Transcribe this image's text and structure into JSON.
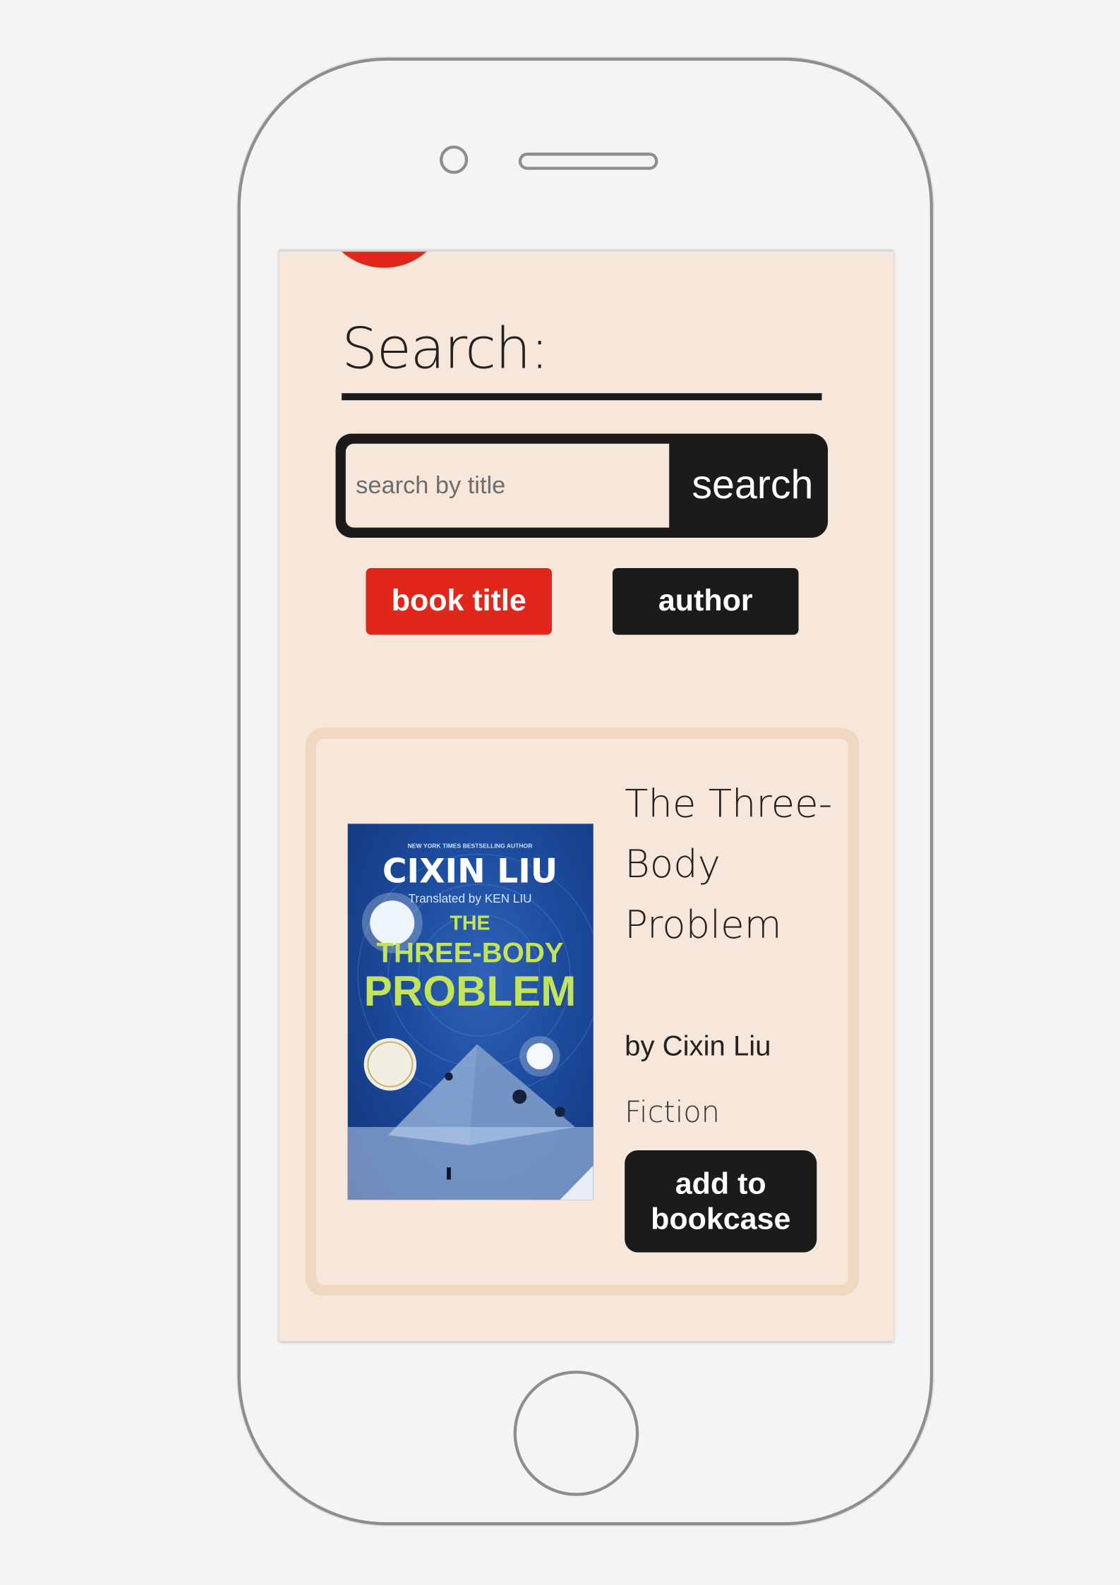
{
  "colors": {
    "screen_bg": "#f6e7da",
    "accent_red": "#e1261c",
    "dark": "#1b1b1b",
    "card_border": "#f0d8c0"
  },
  "search": {
    "heading": "Search:",
    "placeholder": "search by title",
    "value": "",
    "button_label": "search"
  },
  "filters": {
    "options": [
      "book title",
      "author"
    ],
    "selected": "book title"
  },
  "result": {
    "title": "The Three-Body Problem",
    "author": "by Cixin Liu",
    "genre": "Fiction",
    "action_label": "add to bookcase",
    "cover": {
      "kicker": "NEW YORK TIMES BESTSELLING AUTHOR",
      "author": "CIXIN LIU",
      "translator": "Translated by KEN LIU",
      "title_line1": "THE",
      "title_line2": "THREE-BODY",
      "title_line3": "PROBLEM"
    }
  }
}
